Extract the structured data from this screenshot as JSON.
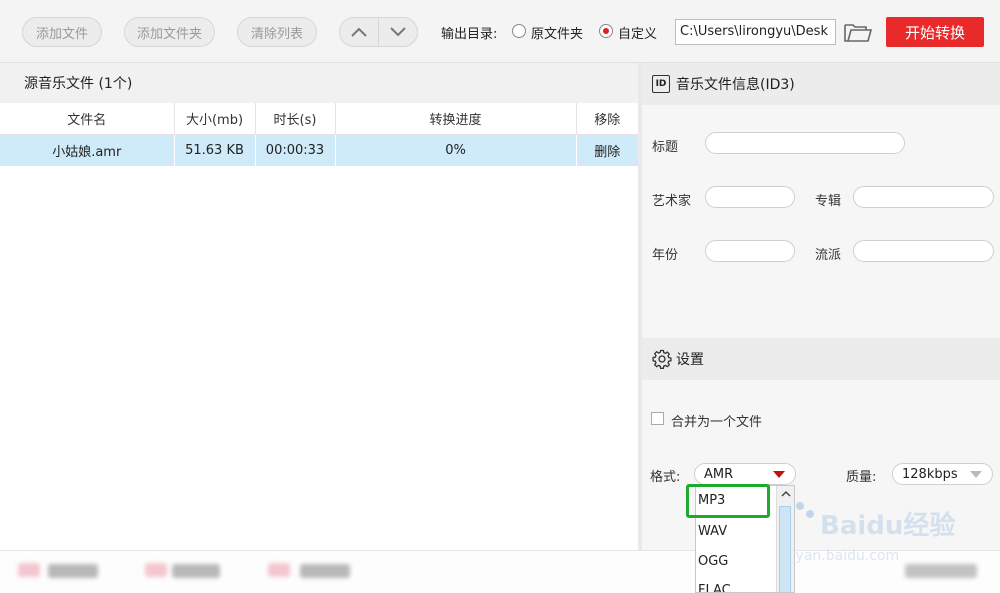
{
  "toolbar": {
    "add_file": "添加文件",
    "add_folder": "添加文件夹",
    "clear_list": "清除列表",
    "output_dir_label": "输出目录:",
    "option_source_folder": "原文件夹",
    "option_custom": "自定义",
    "custom_selected": true,
    "output_path": "C:\\Users\\lirongyu\\Desk",
    "start_button": "开始转换"
  },
  "file_list": {
    "title": "源音乐文件 (1个)",
    "columns": [
      "文件名",
      "大小(mb)",
      "时长(s)",
      "转换进度",
      "移除"
    ],
    "rows": [
      {
        "name": "小姑娘.amr",
        "size": "51.63 KB",
        "duration": "00:00:33",
        "progress": "0%",
        "remove": "删除"
      }
    ]
  },
  "id3": {
    "title": "音乐文件信息(ID3)",
    "icon_text": "ID",
    "title_label": "标题",
    "artist_label": "艺术家",
    "album_label": "专辑",
    "year_label": "年份",
    "genre_label": "流派"
  },
  "settings": {
    "title": "设置",
    "merge_label": "合并为一个文件",
    "merge_checked": false,
    "format_label": "格式:",
    "format_value": "AMR",
    "quality_label": "质量:",
    "quality_value": "128kbps",
    "format_options": [
      "MP3",
      "WAV",
      "OGG",
      "FLAC"
    ]
  },
  "watermark": {
    "text": "Baidu经验",
    "sub": "jingyan.baidu.com"
  },
  "colors": {
    "accent": "#e82a2a",
    "row_selected": "#cfeaf9",
    "highlight": "#1eab2c"
  }
}
